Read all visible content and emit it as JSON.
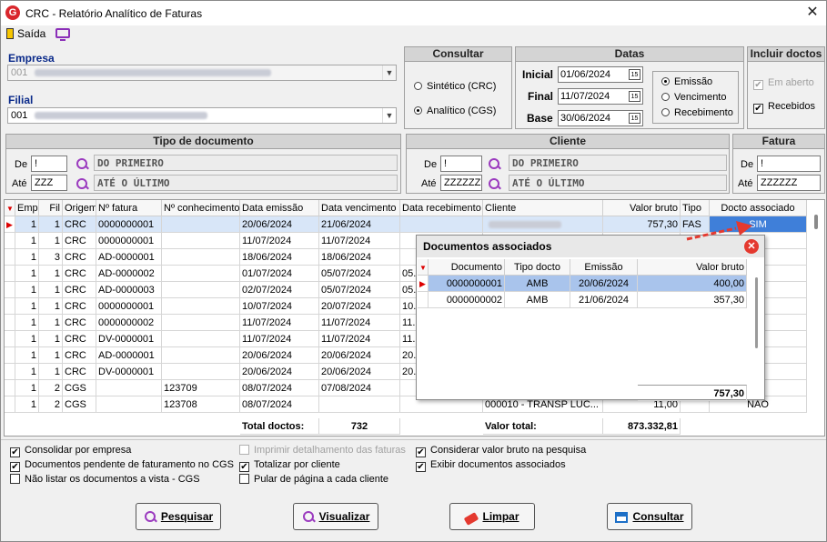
{
  "window": {
    "title": "CRC - Relatório Analítico de Faturas",
    "close": "✕"
  },
  "toolbar": {
    "exit_label": "Saída"
  },
  "empresa": {
    "label": "Empresa",
    "value": "001"
  },
  "filial": {
    "label": "Filial",
    "value": "001"
  },
  "consultar": {
    "title": "Consultar",
    "options": [
      "Sintético (CRC)",
      "Analítico (CGS)"
    ],
    "selected": "Analítico (CGS)"
  },
  "datas": {
    "title": "Datas",
    "inicial_label": "Inicial",
    "inicial": "01/06/2024",
    "final_label": "Final",
    "final": "11/07/2024",
    "base_label": "Base",
    "base": "30/06/2024",
    "types": [
      "Emissão",
      "Vencimento",
      "Recebimento"
    ],
    "selected": "Emissão"
  },
  "incluir": {
    "title": "Incluir doctos",
    "em_aberto": "Em aberto",
    "recebidos": "Recebidos"
  },
  "tipo_documento": {
    "title": "Tipo de documento",
    "de_label": "De",
    "ate_label": "Até",
    "de_code": "!",
    "ate_code": "ZZZ",
    "de_desc": "DO PRIMEIRO",
    "ate_desc": "ATÉ O ÚLTIMO"
  },
  "cliente": {
    "title": "Cliente",
    "de_label": "De",
    "ate_label": "Até",
    "de_code": "!",
    "ate_code": "ZZZZZZ",
    "de_desc": "DO PRIMEIRO",
    "ate_desc": "ATÉ O ÚLTIMO"
  },
  "fatura": {
    "title": "Fatura",
    "de_label": "De",
    "ate_label": "Até",
    "de_code": "!",
    "ate_code": "ZZZZZZ"
  },
  "grid": {
    "columns": [
      "Emp",
      "Fil",
      "Origem",
      "Nº fatura",
      "Nº conhecimento",
      "Data emissão",
      "Data vencimento",
      "Data recebimento",
      "Cliente",
      "Valor bruto",
      "Tipo",
      "Docto associado"
    ],
    "rows": [
      [
        "1",
        "1",
        "CRC",
        "0000000001",
        "",
        "20/06/2024",
        "21/06/2024",
        "",
        "",
        "757,30",
        "FAS",
        "SIM"
      ],
      [
        "1",
        "1",
        "CRC",
        "0000000001",
        "",
        "11/07/2024",
        "11/07/2024",
        "",
        "",
        "",
        "",
        ""
      ],
      [
        "1",
        "3",
        "CRC",
        "AD-0000001",
        "",
        "18/06/2024",
        "18/06/2024",
        "",
        "",
        "",
        "",
        ""
      ],
      [
        "1",
        "1",
        "CRC",
        "AD-0000002",
        "",
        "01/07/2024",
        "05/07/2024",
        "05.",
        "",
        "",
        "",
        ""
      ],
      [
        "1",
        "1",
        "CRC",
        "AD-0000003",
        "",
        "02/07/2024",
        "05/07/2024",
        "05.",
        "",
        "",
        "",
        ""
      ],
      [
        "1",
        "1",
        "CRC",
        "0000000001",
        "",
        "10/07/2024",
        "20/07/2024",
        "10.",
        "",
        "",
        "",
        ""
      ],
      [
        "1",
        "1",
        "CRC",
        "0000000002",
        "",
        "11/07/2024",
        "11/07/2024",
        "11.",
        "",
        "",
        "",
        ""
      ],
      [
        "1",
        "1",
        "CRC",
        "DV-0000001",
        "",
        "11/07/2024",
        "11/07/2024",
        "11.",
        "",
        "",
        "",
        ""
      ],
      [
        "1",
        "1",
        "CRC",
        "AD-0000001",
        "",
        "20/06/2024",
        "20/06/2024",
        "20.",
        "",
        "",
        "",
        ""
      ],
      [
        "1",
        "1",
        "CRC",
        "DV-0000001",
        "",
        "20/06/2024",
        "20/06/2024",
        "20.",
        "",
        "",
        "",
        ""
      ],
      [
        "1",
        "2",
        "CGS",
        "",
        "123709",
        "08/07/2024",
        "07/08/2024",
        "",
        "",
        "",
        "",
        ""
      ],
      [
        "1",
        "2",
        "CGS",
        "",
        "123708",
        "08/07/2024",
        "",
        "",
        "000010 - TRANSP LUC...",
        "11,00",
        "",
        "NÃO"
      ]
    ],
    "total_doctos_label": "Total doctos:",
    "total_doctos": "732",
    "valor_total_label": "Valor total:",
    "valor_total": "873.332,81"
  },
  "popup": {
    "title": "Documentos associados",
    "columns": [
      "Documento",
      "Tipo docto",
      "Emissão",
      "Valor bruto"
    ],
    "rows": [
      [
        "0000000001",
        "AMB",
        "20/06/2024",
        "400,00"
      ],
      [
        "0000000002",
        "AMB",
        "21/06/2024",
        "357,30"
      ]
    ],
    "total": "757,30"
  },
  "options": {
    "consolidar": "Consolidar por empresa",
    "pendente": "Documentos pendente de faturamento no CGS",
    "nao_listar": "Não listar os documentos a vista - CGS",
    "imprimir": "Imprimir detalhamento das faturas",
    "totalizar": "Totalizar por cliente",
    "pular": "Pular de página a cada cliente",
    "considerar": "Considerar valor bruto na pesquisa",
    "exibir": "Exibir documentos associados"
  },
  "buttons": {
    "pesquisar": "Pesquisar",
    "visualizar": "Visualizar",
    "limpar": "Limpar",
    "consultar": "Consultar"
  },
  "colors": {
    "accent_red": "#e4392f",
    "selection": "#a9c4ec",
    "header_blue": "#0a2a8a"
  }
}
